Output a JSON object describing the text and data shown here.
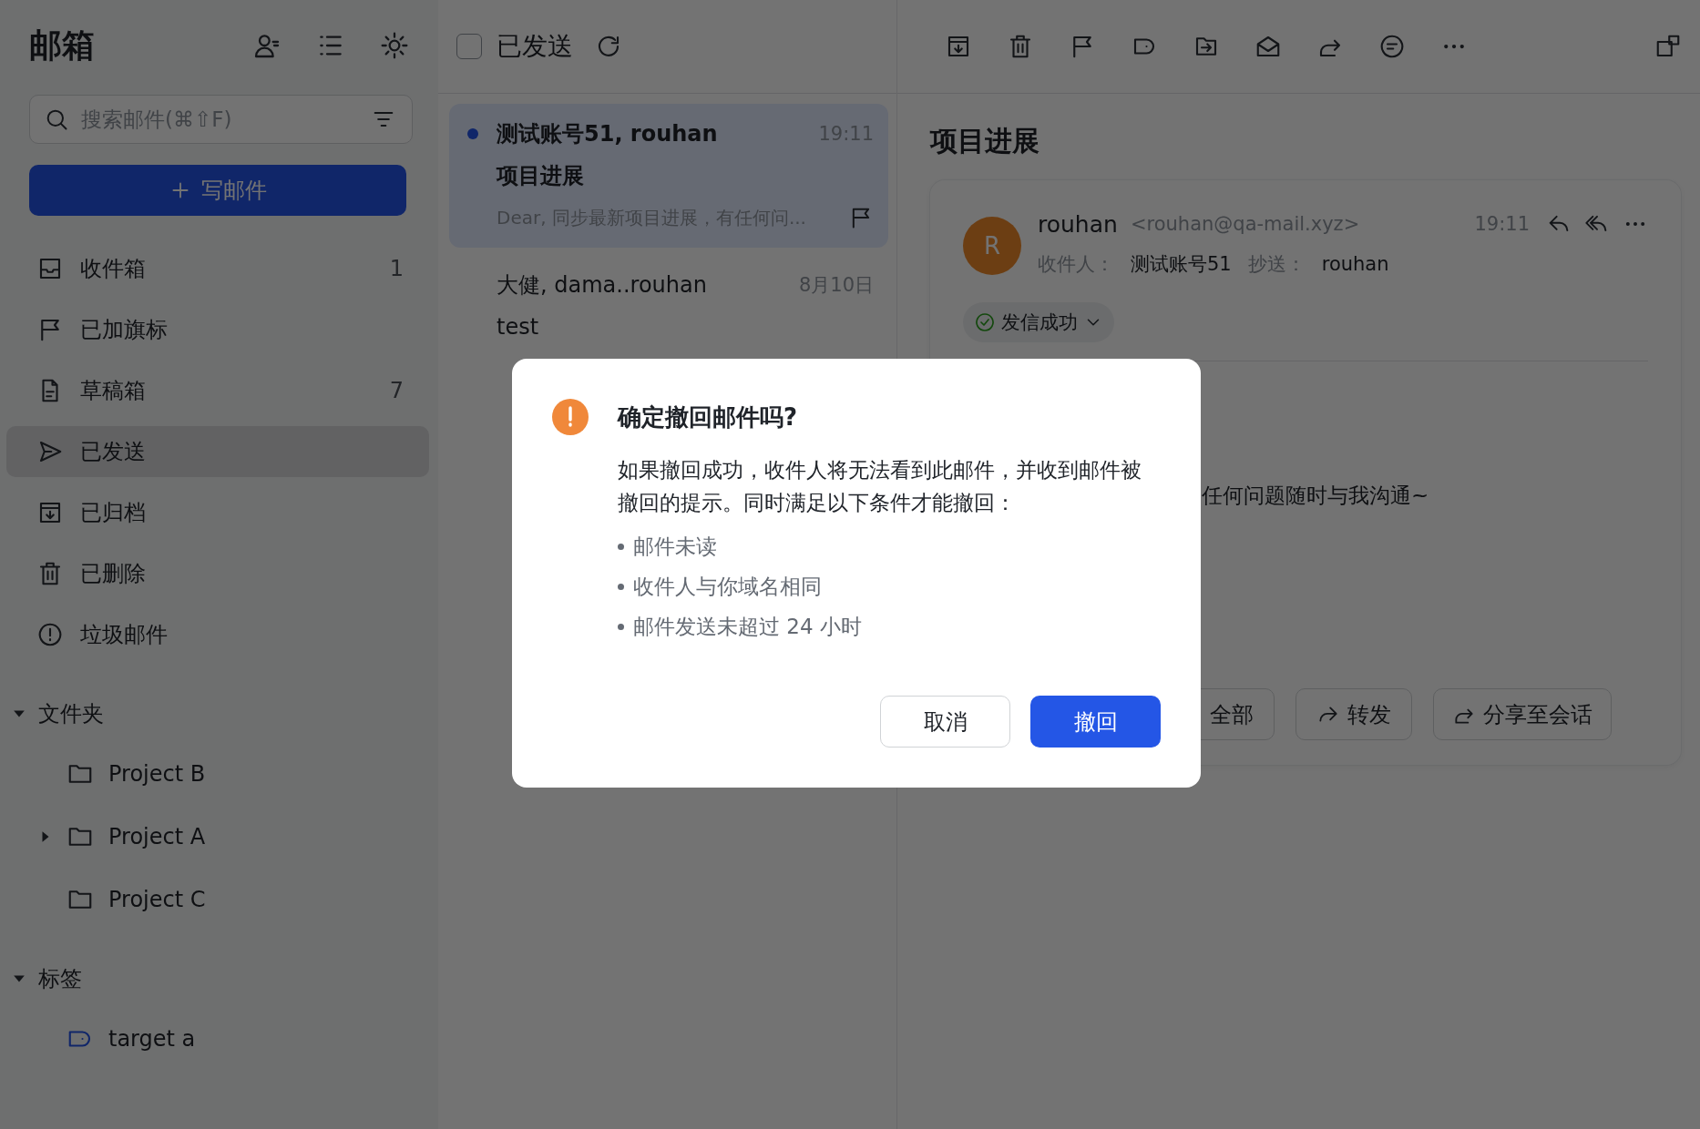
{
  "sidebar": {
    "title": "邮箱",
    "search": {
      "placeholder": "搜索邮件(⌘⇧F)"
    },
    "compose_button": "写邮件",
    "nav_items": [
      {
        "label": "收件箱",
        "count": "1",
        "selected": false
      },
      {
        "label": "已加旗标",
        "selected": false
      },
      {
        "label": "草稿箱",
        "count": "7",
        "selected": false
      },
      {
        "label": "已发送",
        "selected": true
      },
      {
        "label": "已归档",
        "selected": false
      },
      {
        "label": "已删除",
        "selected": false
      },
      {
        "label": "垃圾邮件",
        "selected": false
      }
    ],
    "sections": [
      {
        "label": "文件夹",
        "expanded": true,
        "kind": "folder",
        "children": [
          {
            "label": "Project B",
            "expandable": false
          },
          {
            "label": "Project A",
            "expandable": true
          },
          {
            "label": "Project C",
            "expandable": false
          }
        ]
      },
      {
        "label": "标签",
        "expanded": true,
        "kind": "tag",
        "children": [
          {
            "label": "target a",
            "expandable": false
          }
        ]
      }
    ]
  },
  "mail_list": {
    "title": "已发送",
    "select_all": {
      "checked": false
    },
    "emails": [
      {
        "sender": "测试账号51, rouhan",
        "time": "19:11",
        "subject": "项目进展",
        "preview": "Dear, 同步最新项目进展，有任何问...",
        "unread": true,
        "selected": true
      },
      {
        "sender": "大健, dama..rouhan",
        "time": "8月10日",
        "subject": "test",
        "unread": false,
        "selected": false
      }
    ]
  },
  "reader": {
    "subject": "项目进展",
    "message": {
      "avatar": "R",
      "sender_name": "rouhan",
      "sender_email": "<rouhan@qa-mail.xyz>",
      "time": "19:11",
      "to_label": "收件人：",
      "to": "测试账号51",
      "cc_label": "抄送：",
      "cc": "rouhan",
      "status": "发信成功",
      "body": "任何问题随时与我沟通~"
    },
    "actions": [
      {
        "label": "全部",
        "kind": "reply_all"
      },
      {
        "label": "转发",
        "kind": "forward"
      },
      {
        "label": "分享至会话",
        "kind": "share"
      }
    ]
  },
  "dialog": {
    "title": "确定撤回邮件吗?",
    "message": "如果撤回成功，收件人将无法看到此邮件，并收到邮件被撤回的提示。同时满足以下条件才能撤回：",
    "conditions": [
      "邮件未读",
      "收件人与你域名相同",
      "邮件发送未超过 24 小时"
    ],
    "cancel_button": "取消",
    "confirm_button": "撤回"
  }
}
